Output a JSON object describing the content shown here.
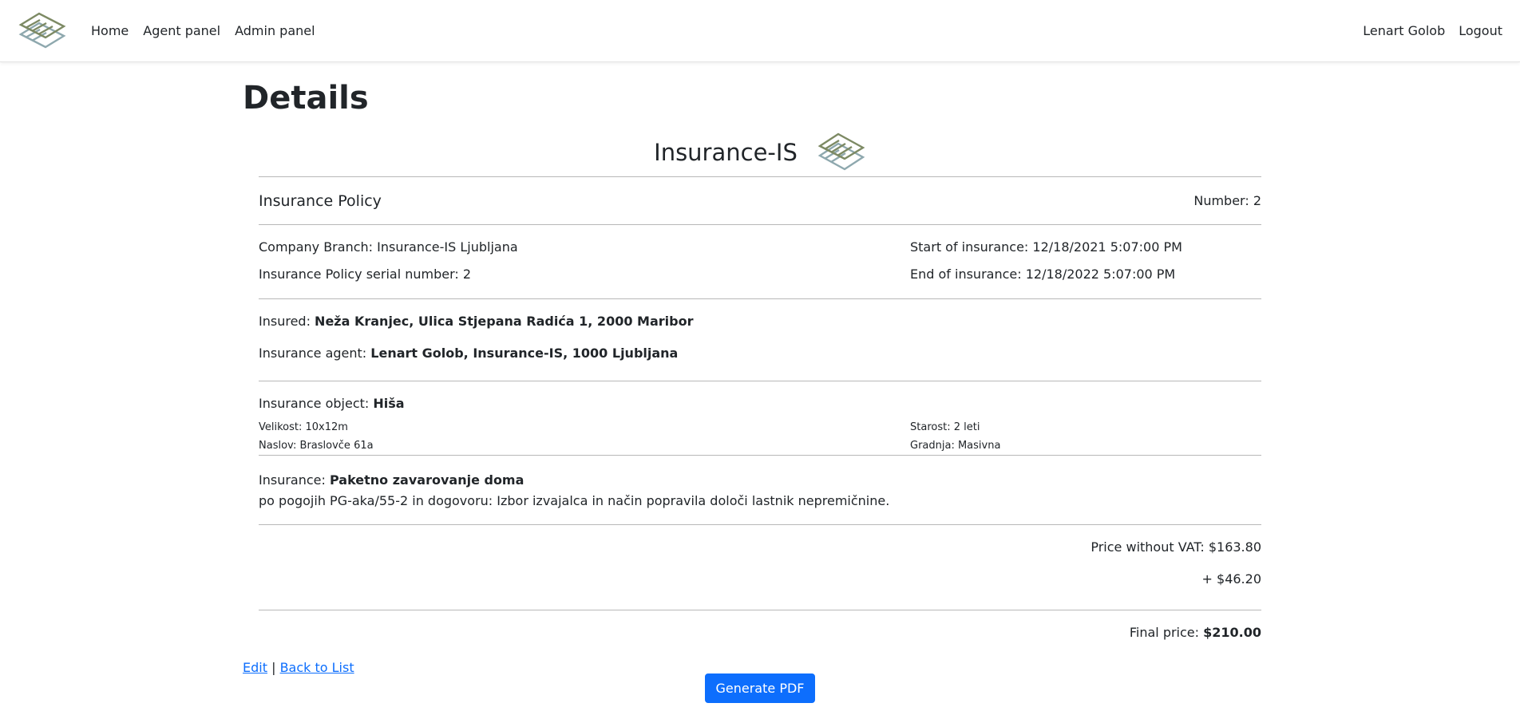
{
  "nav": {
    "home": "Home",
    "agent_panel": "Agent panel",
    "admin_panel": "Admin panel",
    "user_name": "Lenart Golob",
    "logout": "Logout"
  },
  "page": {
    "title": "Details"
  },
  "document": {
    "company_name": "Insurance-IS",
    "policy_title": "Insurance Policy",
    "policy_number": "Number: 2",
    "company_branch": "Company Branch: Insurance-IS Ljubljana",
    "serial_number": "Insurance Policy serial number: 2",
    "start": "Start of insurance: 12/18/2021 5:07:00 PM",
    "end": "End of insurance: 12/18/2022 5:07:00 PM",
    "insured_label": "Insured: ",
    "insured_value": "Neža Kranjec, Ulica Stjepana Radića 1, 2000 Maribor",
    "agent_label": "Insurance agent: ",
    "agent_value": "Lenart Golob, Insurance-IS, 1000 Ljubljana",
    "object_label": "Insurance object: ",
    "object_value": "Hiša",
    "size": "Velikost: 10x12m",
    "address": "Naslov: Braslovče 61a",
    "age": "Starost: 2 leti",
    "construction": "Gradnja: Masivna",
    "insurance_label": "Insurance: ",
    "insurance_value": "Paketno zavarovanje doma",
    "insurance_desc": "po pogojih PG-aka/55-2 in dogovoru: Izbor izvajalca in način popravila določi lastnik nepremičnine.",
    "price_without_vat": "Price without VAT: $163.80",
    "vat": "+ $46.20",
    "final_label": "Final price: ",
    "final_value": "$210.00"
  },
  "actions": {
    "edit": "Edit",
    "separator": "|",
    "back_to_list": "Back to List",
    "generate_pdf": "Generate PDF"
  },
  "colors": {
    "logo_top": "#7d8a64",
    "logo_bottom": "#8ea8ae",
    "primary": "#0d6efd",
    "link": "#0d6efd"
  }
}
